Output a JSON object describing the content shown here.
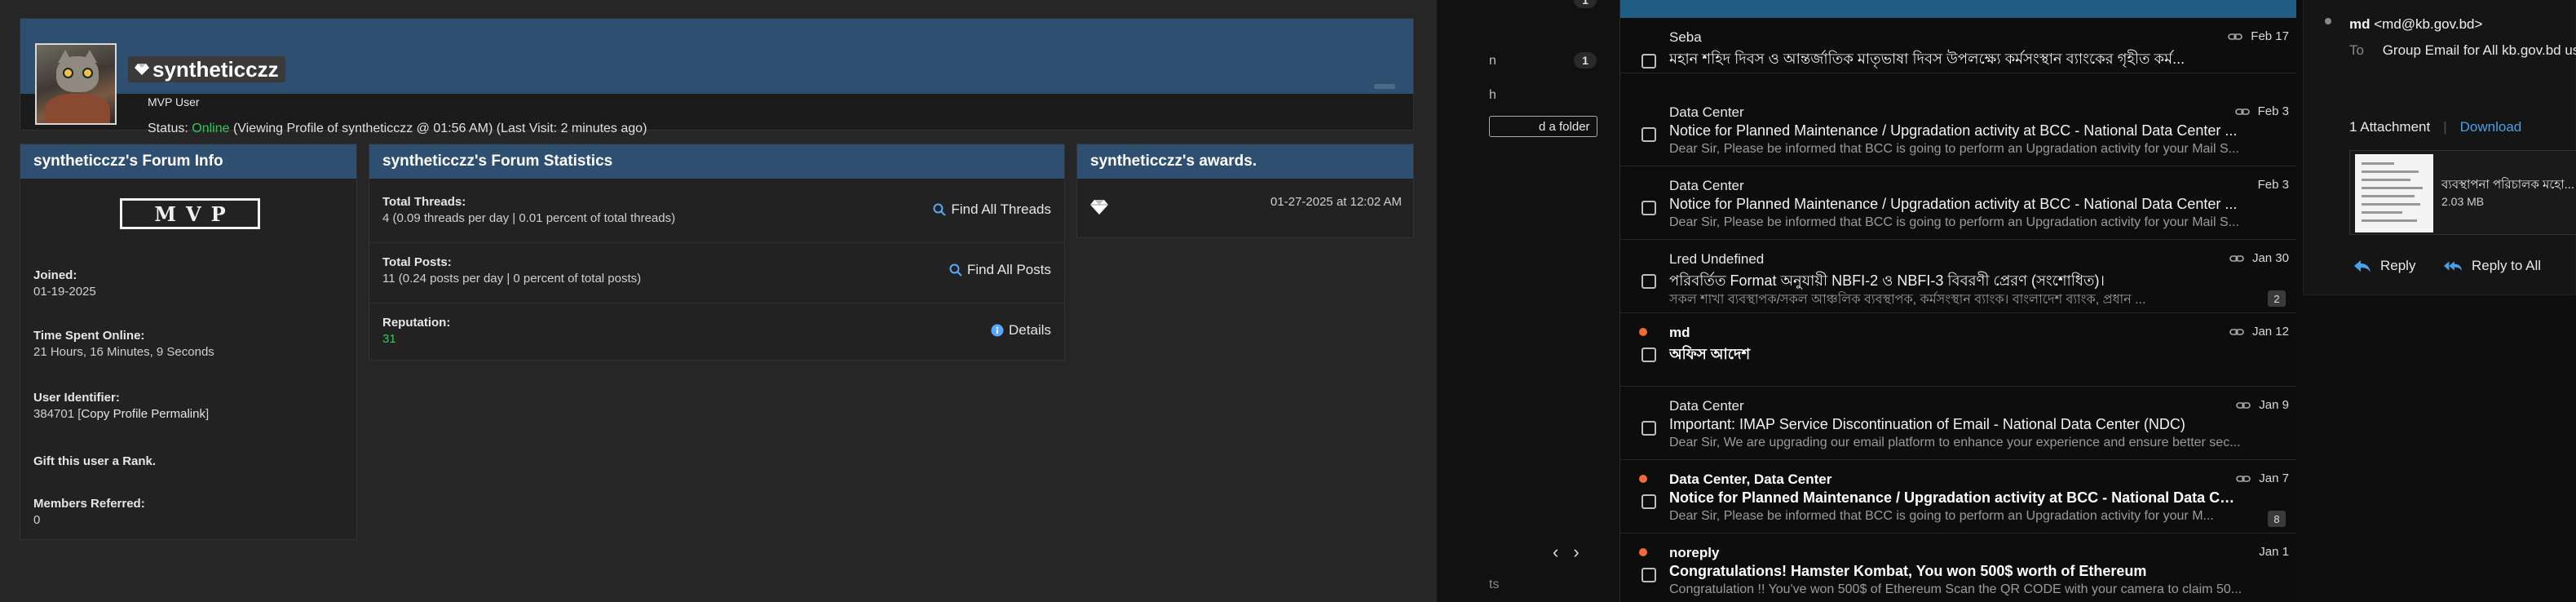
{
  "forum": {
    "username": "syntheticczz",
    "usertitle": "MVP User",
    "status_label": "Status:",
    "status_value": "Online",
    "status_rest": "(Viewing Profile of syntheticczz @ 01:56 AM) (Last Visit: 2 minutes ago)",
    "info": {
      "title": "syntheticczz's Forum Info",
      "badge": "MVP",
      "joined_label": "Joined:",
      "joined_value": "01-19-2025",
      "time_label": "Time Spent Online:",
      "time_value": "21 Hours, 16 Minutes, 9 Seconds",
      "uid_label": "User Identifier:",
      "uid_value": "384701",
      "uid_link": "Copy Profile Permalink",
      "gift_label": "Gift this user a Rank.",
      "referred_label": "Members Referred:",
      "referred_value": "0"
    },
    "stats": {
      "title": "syntheticczz's Forum Statistics",
      "threads_label": "Total Threads:",
      "threads_value": "4 (0.09 threads per day | 0.01 percent of total threads)",
      "threads_link": "Find All Threads",
      "posts_label": "Total Posts:",
      "posts_value": "11 (0.24 posts per day | 0 percent of total posts)",
      "posts_link": "Find All Posts",
      "rep_label": "Reputation:",
      "rep_value": "31",
      "rep_link": "Details"
    },
    "awards": {
      "title": "syntheticczz's awards.",
      "date": "01-27-2025 at 12:02 AM"
    }
  },
  "mail_sidebar": {
    "badge_top": "1",
    "item_n": "n",
    "badge_n": "1",
    "item_h": "h",
    "add_folder": "d a folder",
    "bottom": "ts"
  },
  "mail_list": [
    {
      "from": "Seba",
      "subject": "মহান শহিদ দিবস ও আন্তর্জাতিক মাতৃভাষা দিবস উপলক্ষ্যে কর্মসংস্থান ব্যাংকের গৃহীত কর্ম...",
      "preview": "",
      "date": "Feb 17",
      "unread": false,
      "count": ""
    },
    {
      "from": "Data Center",
      "subject": "Notice for Planned Maintenance / Upgradation activity at BCC - National Data Center ...",
      "preview": "Dear Sir,  Please be informed that BCC is going to perform an Upgradation activity for your Mail S...",
      "date": "Feb 3",
      "unread": false,
      "count": ""
    },
    {
      "from": "Data Center",
      "subject": "Notice for Planned Maintenance / Upgradation activity at BCC - National Data Center ...",
      "preview": "Dear Sir, Please be informed that BCC is going to perform an Upgradation activity for your Mail S...",
      "date": "Feb 3",
      "unread": false,
      "count": ""
    },
    {
      "from": "Lred Undefined",
      "subject": "পরিবর্তিত Format অনুযায়ী NBFI-2 ও NBFI-3 বিবরণী প্রেরণ (সংশোধিত)।",
      "preview": "   সকল শাখা ব্যবস্থাপক/সকল আঞ্চলিক ব্যবস্থাপক, কর্মসংস্থান ব্যাংক।   বাংলাদেশ ব্যাংক, প্রধান ...",
      "date": "Jan 30",
      "unread": false,
      "count": "2"
    },
    {
      "from": "md",
      "subject": "অফিস আদেশ",
      "preview": "",
      "date": "Jan 12",
      "unread": true,
      "count": ""
    },
    {
      "from": "Data Center",
      "subject": "Important: IMAP Service Discontinuation of Email - National Data Center (NDC)",
      "preview": "Dear Sir, We are upgrading our email platform to enhance your experience and ensure better sec...",
      "date": "Jan 9",
      "unread": false,
      "count": ""
    },
    {
      "from": "Data Center, Data Center",
      "subject": "Notice for Planned Maintenance / Upgradation activity at BCC - National Data Center (N...",
      "preview": "Dear Sir, Please be informed that BCC is going to perform an Upgradation activity for your M...",
      "date": "Jan 7",
      "unread": true,
      "count": "8"
    },
    {
      "from": "noreply",
      "subject": "Congratulations! Hamster Kombat, You won 500$ worth of Ethereum",
      "preview": "Congratulation !! You've won 500$ of Ethereum Scan the QR CODE with your camera to claim 50...",
      "date": "Jan 1",
      "unread": true,
      "count": ""
    }
  ],
  "reading": {
    "from_name": "md",
    "from_email": "<md@kb.gov.bd>",
    "to_label": "To",
    "to_value": "Group Email for All kb.gov.bd us",
    "attachments": "1 Attachment",
    "download": "Download",
    "file_name": "ব্যবস্থাপনা পরিচালক মহো...",
    "file_size": "2.03 MB",
    "reply": "Reply",
    "reply_all": "Reply to All"
  },
  "colors": {
    "header_blue": "#2f4f70",
    "online_green": "#34c759",
    "unread_dot": "#f06b3a",
    "link_blue": "#4a9fe8"
  }
}
